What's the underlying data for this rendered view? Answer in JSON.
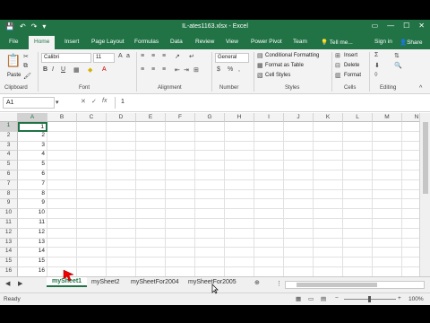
{
  "window": {
    "title": "IL-ates1163.xlsx - Excel"
  },
  "tabs": [
    "File",
    "Home",
    "Insert",
    "Page Layout",
    "Formulas",
    "Data",
    "Review",
    "View",
    "Power Pivot",
    "Team"
  ],
  "active_tab": "Home",
  "tell_me": "Tell me...",
  "signin": "Sign in",
  "share": "Share",
  "ribbon": {
    "groups": [
      "Clipboard",
      "Font",
      "Alignment",
      "Number",
      "Styles",
      "Cells",
      "Editing"
    ],
    "paste": "Paste",
    "font_name": "Calibri",
    "font_size": "11",
    "number_format": "General",
    "conditional_formatting": "Conditional Formatting",
    "format_as_table": "Format as Table",
    "cell_styles": "Cell Styles",
    "insert": "Insert",
    "delete": "Delete",
    "format": "Format"
  },
  "formula_bar": {
    "name_box": "A1",
    "fx": "fx",
    "value": "1"
  },
  "columns": [
    "A",
    "B",
    "C",
    "D",
    "E",
    "F",
    "G",
    "H",
    "I",
    "J",
    "K",
    "L",
    "M",
    "N"
  ],
  "rows": [
    "1",
    "2",
    "3",
    "4",
    "5",
    "6",
    "7",
    "8",
    "9",
    "10",
    "11",
    "12",
    "13",
    "14",
    "15",
    "16",
    "17"
  ],
  "col_a_values": [
    "1",
    "2",
    "3",
    "4",
    "5",
    "6",
    "7",
    "8",
    "9",
    "10",
    "11",
    "12",
    "13",
    "14",
    "15",
    "16",
    ""
  ],
  "sheets": [
    "mySheet1",
    "mySheet2",
    "mySheetFor2004",
    "mySheetFor2005"
  ],
  "active_sheet": "mySheet1",
  "status": {
    "ready": "Ready",
    "zoom": "100%"
  }
}
